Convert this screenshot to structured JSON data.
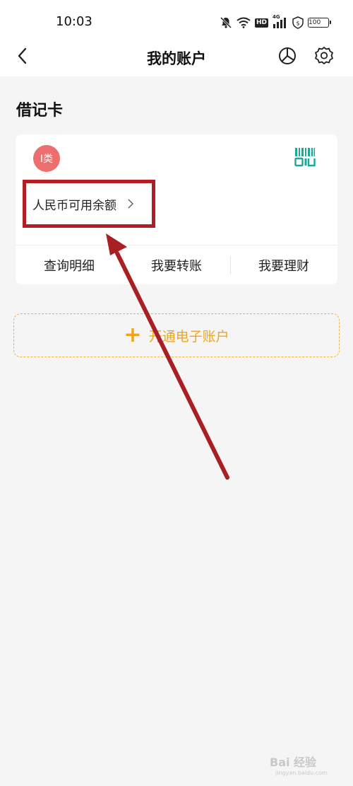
{
  "status_bar": {
    "time": "10:03",
    "network": "4G",
    "hd": "HD",
    "battery": "100",
    "icons": [
      "bell-muted-icon",
      "wifi-icon",
      "hd-icon",
      "signal-icon",
      "vpn-icon",
      "battery-icon"
    ]
  },
  "nav": {
    "title": "我的账户",
    "icons": [
      "back-icon",
      "pie-chart-icon",
      "gear-icon"
    ]
  },
  "section": {
    "title": "借记卡"
  },
  "card": {
    "badge": "I类",
    "qr_icon": "qr-code-icon",
    "balance_label": "人民币可用余额",
    "actions": [
      "查询明细",
      "我要转账",
      "我要理财"
    ]
  },
  "open_account": {
    "label": "开通电子账户"
  },
  "watermark": {
    "main": "Bai 经验",
    "sub": "jingyan.baidu.com"
  },
  "colors": {
    "background": "#f5f5f5",
    "accent": "#f0a51c",
    "badge": "#ec6e6e",
    "qr": "#1aa89a",
    "annotation": "#b01f24"
  }
}
